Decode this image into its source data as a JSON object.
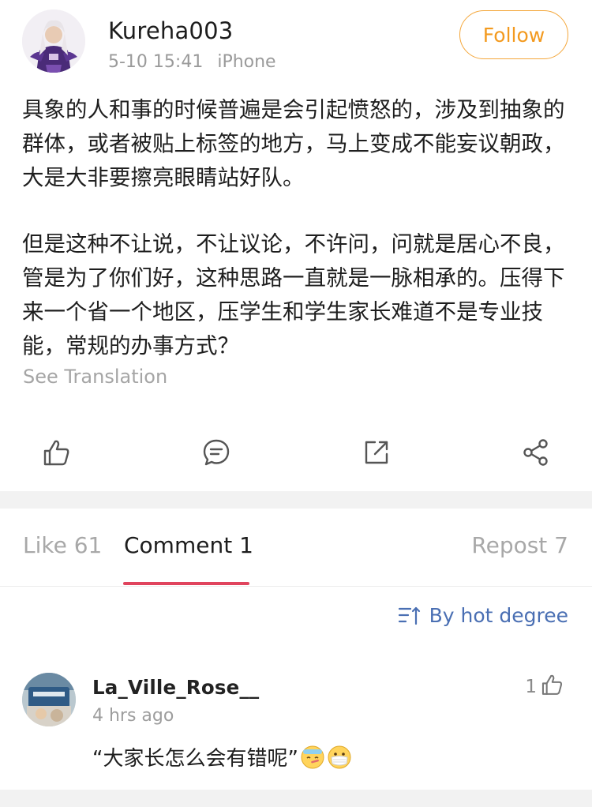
{
  "post": {
    "username": "Kureha003",
    "time": "5-10 15:41",
    "device": "iPhone",
    "follow_label": "Follow",
    "paragraphs": [
      "具象的人和事的时候普遍是会引起愤怒的，涉及到抽象的群体，或者被贴上标签的地方，马上变成不能妄议朝政，大是大非要擦亮眼睛站好队。",
      "但是这种不让说，不让议论，不许问，问就是居心不良，管是为了你们好，这种思路一直就是一脉相承的。压得下来一个省一个地区，压学生和学生家长难道不是专业技能，常规的办事方式？"
    ],
    "see_translation": "See Translation"
  },
  "actions": {
    "icons": [
      "thumbs-up-icon",
      "comment-icon",
      "repost-icon",
      "share-icon"
    ]
  },
  "tabs": {
    "like": "Like 61",
    "comment": "Comment 1",
    "repost": "Repost 7"
  },
  "sort": {
    "label": "By hot degree",
    "icon": "sort-icon"
  },
  "comments": [
    {
      "username": "La_Ville_Rose__",
      "time": "4 hrs ago",
      "likes": "1",
      "text": "“大家长怎么会有错呢”",
      "emojis": [
        "sick-face-emoji",
        "mask-face-emoji"
      ]
    }
  ],
  "colors": {
    "follow": "#f39a1f",
    "tab_underline": "#e0445d",
    "sort_link": "#4a6fb3"
  }
}
